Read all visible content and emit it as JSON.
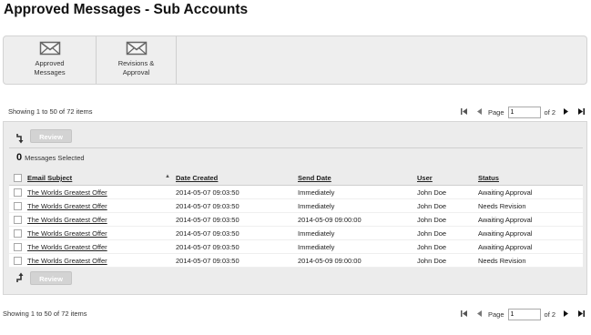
{
  "page": {
    "title": "Approved Messages - Sub Accounts"
  },
  "toolbar": {
    "items": [
      {
        "label_line1": "Approved",
        "label_line2": "Messages",
        "icon": "envelope-icon"
      },
      {
        "label_line1": "Revisions &",
        "label_line2": "Approval",
        "icon": "envelope-icon"
      }
    ]
  },
  "pagination_top": {
    "showing": "Showing 1 to 50 of 72 items",
    "page_label": "Page",
    "page_value": "1",
    "of_label": "of 2"
  },
  "pagination_bottom": {
    "showing": "Showing 1 to 50 of 72 items",
    "page_label": "Page",
    "page_value": "1",
    "of_label": "of 2"
  },
  "panel": {
    "review_label": "Review",
    "selected_count": "0",
    "selected_label": "Messages Selected"
  },
  "table": {
    "columns": [
      "Email Subject",
      "Date Created",
      "Send Date",
      "User",
      "Status"
    ],
    "rows": [
      [
        "The Worlds Greatest Offer",
        "2014-05-07 09:03:50",
        "Immediately",
        "John Doe",
        "Awaiting Approval"
      ],
      [
        "The Worlds Greatest Offer",
        "2014-05-07 09:03:50",
        "Immediately",
        "John Doe",
        "Needs Revision"
      ],
      [
        "The Worlds Greatest Offer",
        "2014-05-07 09:03:50",
        "2014-05-09 09:00:00",
        "John Doe",
        "Awaiting Approval"
      ],
      [
        "The Worlds Greatest Offer",
        "2014-05-07 09:03:50",
        "Immediately",
        "John Doe",
        "Awaiting Approval"
      ],
      [
        "The Worlds Greatest Offer",
        "2014-05-07 09:03:50",
        "Immediately",
        "John Doe",
        "Awaiting Approval"
      ],
      [
        "The Worlds Greatest Offer",
        "2014-05-07 09:03:50",
        "2014-05-09 09:00:00",
        "John Doe",
        "Needs Revision"
      ]
    ]
  },
  "colors": {
    "toolbar_bg": "#eeeeee",
    "panel_bg": "#ececec",
    "button_disabled": "#d3d3d3"
  }
}
